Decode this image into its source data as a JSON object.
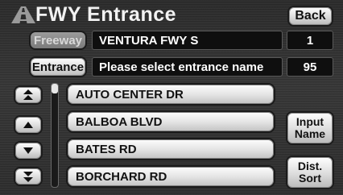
{
  "header": {
    "title": "FWY Entrance",
    "back_label": "Back"
  },
  "freeway": {
    "tab_label": "Freeway",
    "value": "VENTURA FWY S",
    "count": "1"
  },
  "entrance": {
    "tab_label": "Entrance",
    "value": "Please select entrance name",
    "count": "95"
  },
  "list": {
    "items": [
      {
        "label": "AUTO CENTER DR"
      },
      {
        "label": "BALBOA BLVD"
      },
      {
        "label": "BATES RD"
      },
      {
        "label": "BORCHARD RD"
      }
    ]
  },
  "side_buttons": {
    "input_name": [
      "Input",
      "Name"
    ],
    "dist_sort": [
      "Dist.",
      "Sort"
    ]
  },
  "icons": {
    "title": "road-icon",
    "scroll_first": "double-chevron-up-icon",
    "scroll_up": "chevron-up-icon",
    "scroll_down": "chevron-down-icon",
    "scroll_last": "double-chevron-down-icon"
  },
  "colors": {
    "background": "#2f2f2f",
    "field_background": "#0f0f0f",
    "text": "#ffffff",
    "button_face": "#e2e2e2"
  }
}
